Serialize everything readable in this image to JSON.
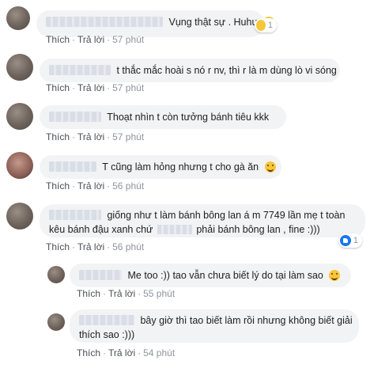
{
  "labels": {
    "like": "Thích",
    "reply": "Trả lời"
  },
  "comments": [
    {
      "text": "Vụng thật sự . Huhu",
      "time": "57 phút",
      "reaction_count": "1",
      "reaction_icon": "haha-reaction-icon"
    },
    {
      "text": "t thắc mắc hoài s nó r nv, thì r là m dùng lò vi sóng",
      "time": "57 phút"
    },
    {
      "text": "Thoạt nhìn t còn tưởng bánh tiêu kkk",
      "time": "57 phút"
    },
    {
      "text": "T cũng làm hỏng nhưng t cho gà ăn",
      "emoji": "rofl-emoji",
      "time": "56 phút"
    },
    {
      "line1": "giống như t làm bánh bông lan á m 7749 lần mẹ t toàn",
      "line2_a": "kêu bánh đậu xanh chứ",
      "line2_b": "phải bánh bông lan , fine :)))",
      "time": "56 phút",
      "reaction_count": "1",
      "reaction_icon": "like-reaction-icon"
    }
  ],
  "replies": [
    {
      "text": "Me too :)) tao vẫn chưa biết lý do tại làm sao",
      "emoji": "confused-emoji",
      "time": "55 phút"
    },
    {
      "line1": "bây giờ thì tao biết làm rồi nhưng không biết giải",
      "line2": "thích sao :)))",
      "time": "54 phút"
    }
  ]
}
